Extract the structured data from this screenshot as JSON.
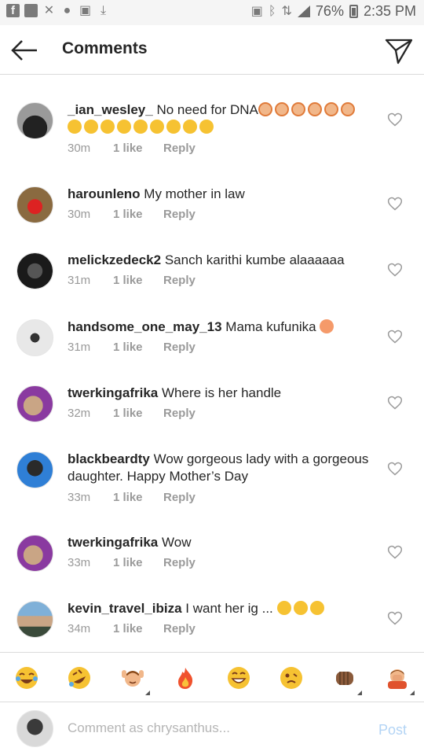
{
  "status_bar": {
    "battery": "76%",
    "time": "2:35 PM"
  },
  "header": {
    "title": "Comments"
  },
  "comments": [
    {
      "user": "_ian_wesley_",
      "text": "No need for DNA",
      "time": "30m",
      "likes": "1 like",
      "reply": "Reply"
    },
    {
      "user": "harounleno",
      "text": "My mother in law",
      "time": "30m",
      "likes": "1 like",
      "reply": "Reply"
    },
    {
      "user": "melickzedeck2",
      "text": "Sanch karithi kumbe alaaaaaa",
      "time": "31m",
      "likes": "1 like",
      "reply": "Reply"
    },
    {
      "user": "handsome_one_may_13",
      "text": "Mama kufunika",
      "time": "31m",
      "likes": "1 like",
      "reply": "Reply"
    },
    {
      "user": "twerkingafrika",
      "text": "Where is her handle",
      "time": "32m",
      "likes": "1 like",
      "reply": "Reply"
    },
    {
      "user": "blackbeardty",
      "text": "Wow gorgeous lady with a gorgeous daughter.  Happy Mother’s Day",
      "time": "33m",
      "likes": "1 like",
      "reply": "Reply"
    },
    {
      "user": "twerkingafrika",
      "text": "Wow",
      "time": "33m",
      "likes": "1 like",
      "reply": "Reply"
    },
    {
      "user": "kevin_travel_ibiza",
      "text": "I want her ig ...",
      "time": "34m",
      "likes": "1 like",
      "reply": "Reply"
    }
  ],
  "emoji_bar": [
    "face-with-tears-of-joy",
    "rolling-on-floor-laughing",
    "raising-hands-person",
    "fire",
    "grinning-face",
    "woozy-face",
    "fist-bump",
    "facepalm-person"
  ],
  "composer": {
    "placeholder": "Comment as chrysanthus...",
    "post_label": "Post"
  },
  "colors": {
    "accent_post": "#b3d4f5",
    "meta_gray": "#9a9a9a",
    "divider": "#dbdbdb"
  }
}
